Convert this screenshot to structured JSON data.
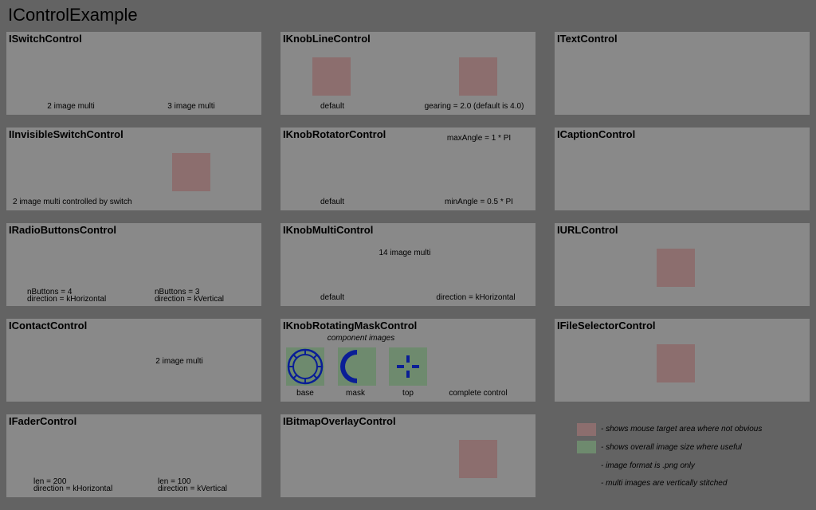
{
  "app_title": "IControlExample",
  "colors": {
    "background": "#636363",
    "panel": "#898989",
    "target": "#8c6e6e",
    "image": "#6e8a6e",
    "icon": "#0a1e96"
  },
  "panels": {
    "switch": {
      "title": "ISwitchControl",
      "label_1": "2 image multi",
      "label_2": "3 image multi"
    },
    "knob_line": {
      "title": "IKnobLineControl",
      "label_1": "default",
      "label_2": "gearing = 2.0 (default is 4.0)"
    },
    "text": {
      "title": "ITextControl"
    },
    "invisible_switch": {
      "title": "IInvisibleSwitchControl",
      "label_1": "2 image multi controlled by switch"
    },
    "knob_rotator": {
      "title": "IKnobRotatorControl",
      "label_max": "maxAngle = 1 * PI",
      "label_1": "default",
      "label_min": "minAngle = 0.5 * PI"
    },
    "caption": {
      "title": "ICaptionControl"
    },
    "radio": {
      "title": "IRadioButtonsControl",
      "label_1a": "nButtons = 4",
      "label_1b": "direction = kHorizontal",
      "label_2a": "nButtons = 3",
      "label_2b": "direction = kVertical"
    },
    "knob_multi": {
      "title": "IKnobMultiControl",
      "label_top": "14 image multi",
      "label_1": "default",
      "label_2": "direction = kHorizontal"
    },
    "url": {
      "title": "IURLControl"
    },
    "contact": {
      "title": "IContactControl",
      "label_1": "2 image multi"
    },
    "knob_mask": {
      "title": "IKnobRotatingMaskControl",
      "label_component": "component images",
      "label_base": "base",
      "label_mask": "mask",
      "label_top": "top",
      "label_complete": "complete control"
    },
    "file_selector": {
      "title": "IFileSelectorControl"
    },
    "fader": {
      "title": "IFaderControl",
      "label_1a": "len = 200",
      "label_1b": "direction = kHorizontal",
      "label_2a": "len = 100",
      "label_2b": "direction = kVertical"
    },
    "bitmap_overlay": {
      "title": "IBitmapOverlayControl"
    }
  },
  "legend": {
    "item_1": "- shows mouse target area where not obvious",
    "item_2": "- shows overall image size where useful",
    "item_3": "- image format is .png only",
    "item_4": "- multi images are vertically stitched"
  }
}
